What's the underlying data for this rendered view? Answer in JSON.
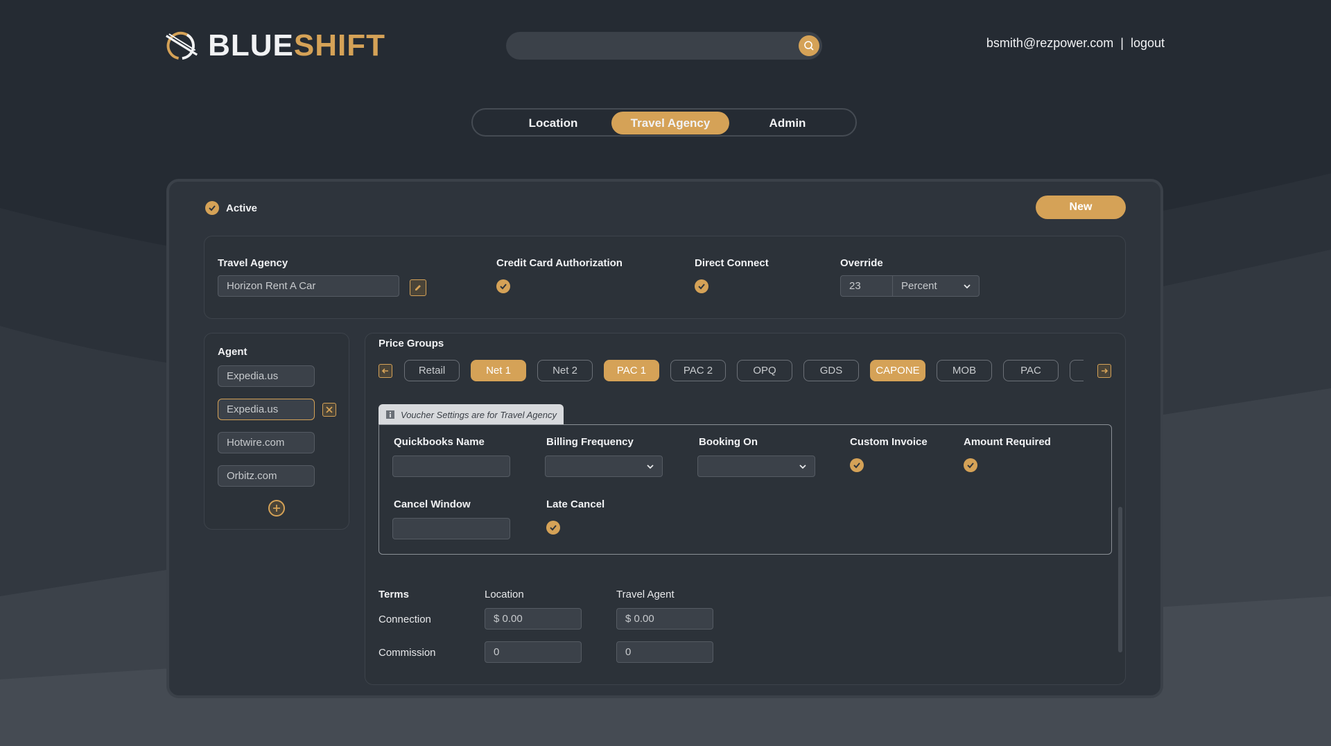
{
  "brand": {
    "name_part1": "BLUE",
    "name_part2": "SHIFT",
    "accent": "#d5a257",
    "background": "#252b33"
  },
  "header": {
    "user_email": "bsmith@rezpower.com",
    "separator": "|",
    "logout_label": "logout",
    "search_icon": "search-icon"
  },
  "tabs": [
    {
      "label": "Location",
      "active": false
    },
    {
      "label": "Travel Agency",
      "active": true
    },
    {
      "label": "Admin",
      "active": false
    }
  ],
  "status": {
    "label": "Active",
    "checked": true
  },
  "new_button": "New",
  "agency": {
    "travel_agency_label": "Travel Agency",
    "travel_agency_value": "Horizon Rent A Car",
    "cc_auth_label": "Credit Card Authorization",
    "cc_auth_checked": true,
    "direct_connect_label": "Direct Connect",
    "direct_connect_checked": true,
    "override_label": "Override",
    "override_value": "23",
    "override_unit": "Percent"
  },
  "agents": {
    "title": "Agent",
    "items": [
      {
        "name": "Expedia.us",
        "selected": false
      },
      {
        "name": "Expedia.us",
        "selected": true
      },
      {
        "name": "Hotwire.com",
        "selected": false
      },
      {
        "name": "Orbitz.com",
        "selected": false
      }
    ]
  },
  "price_groups": {
    "title": "Price Groups",
    "items": [
      {
        "label": "Retail",
        "selected": false
      },
      {
        "label": "Net 1",
        "selected": true
      },
      {
        "label": "Net 2",
        "selected": false
      },
      {
        "label": "PAC 1",
        "selected": true
      },
      {
        "label": "PAC 2",
        "selected": false
      },
      {
        "label": "OPQ",
        "selected": false
      },
      {
        "label": "GDS",
        "selected": false
      },
      {
        "label": "CAPONE",
        "selected": true
      },
      {
        "label": "MOB",
        "selected": false
      },
      {
        "label": "PAC",
        "selected": false
      }
    ]
  },
  "voucher": {
    "tab_label": "Voucher Settings are for Travel Agency",
    "quickbooks_label": "Quickbooks Name",
    "quickbooks_value": "",
    "billing_label": "Billing Frequency",
    "billing_value": "",
    "booking_label": "Booking On",
    "booking_value": "",
    "custom_invoice_label": "Custom Invoice",
    "custom_invoice_checked": true,
    "amount_required_label": "Amount Required",
    "amount_required_checked": true,
    "cancel_window_label": "Cancel Window",
    "cancel_window_value": "",
    "late_cancel_label": "Late Cancel",
    "late_cancel_checked": true
  },
  "terms": {
    "title": "Terms",
    "col_location": "Location",
    "col_agent": "Travel Agent",
    "rows": [
      {
        "label": "Connection",
        "location": "$ 0.00",
        "agent": "$ 0.00"
      },
      {
        "label": "Commission",
        "location": "0",
        "agent": "0"
      }
    ]
  }
}
